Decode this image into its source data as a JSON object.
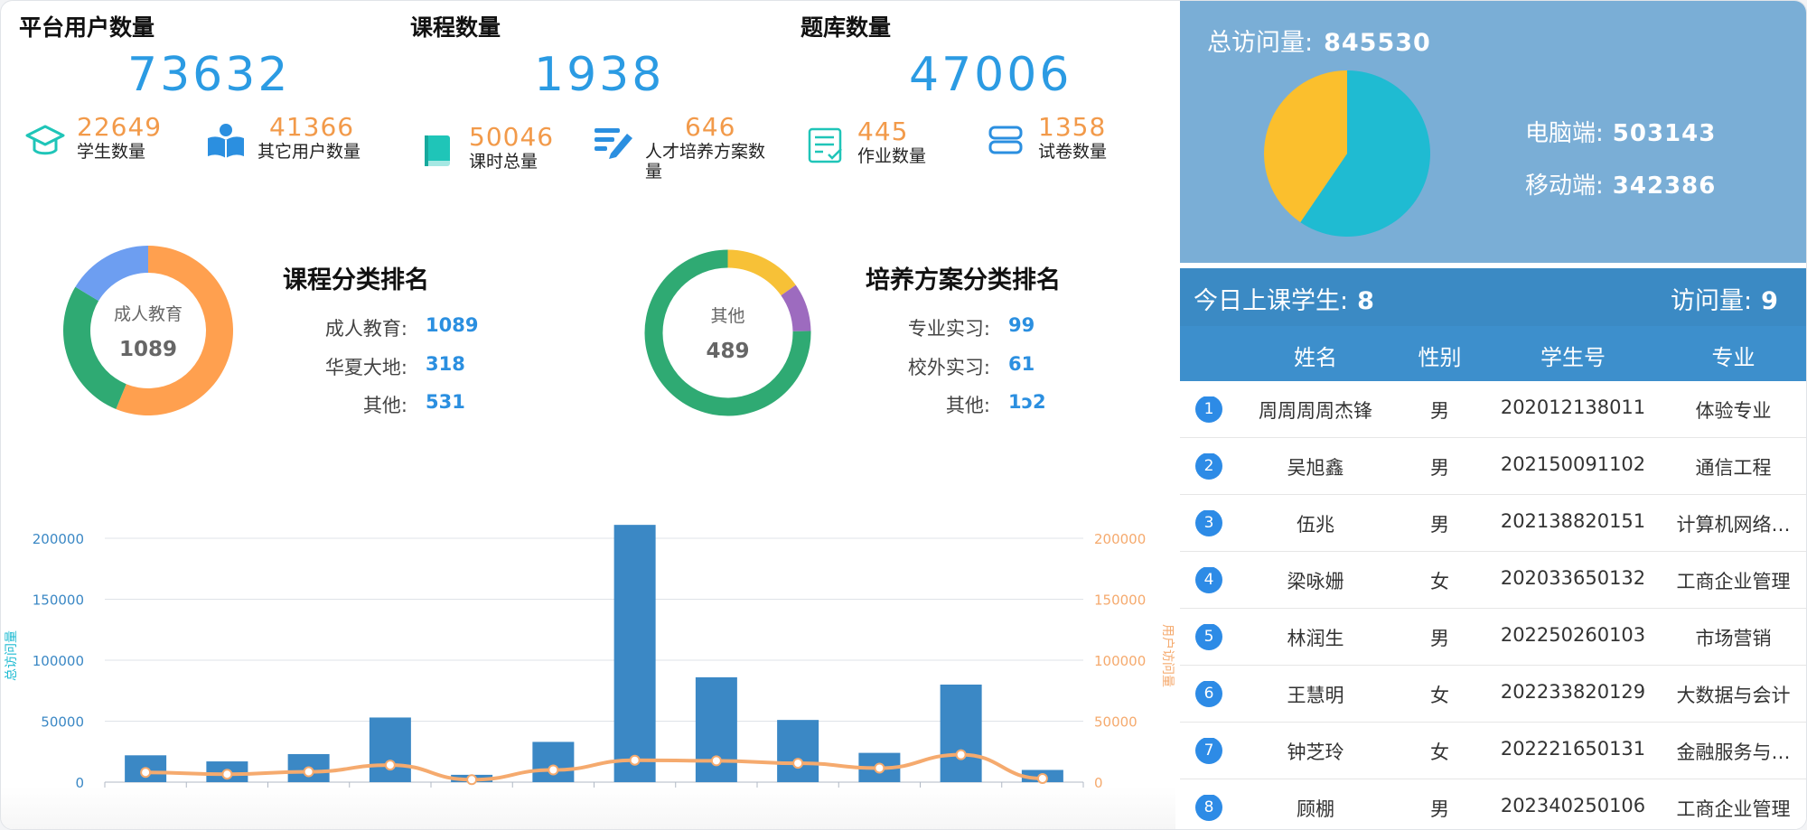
{
  "stats": [
    {
      "title": "平台用户数量",
      "value": "73632"
    },
    {
      "title": "课程数量",
      "value": "1938"
    },
    {
      "title": "题库数量",
      "value": "47006"
    }
  ],
  "subs": [
    {
      "num": "22649",
      "label": "学生数量",
      "icon": "graduation-cap-icon"
    },
    {
      "num": "41366",
      "label": "其它用户数量",
      "icon": "reading-person-icon"
    },
    {
      "num": "50046",
      "label": "课时总量",
      "icon": "book-icon"
    },
    {
      "num": "646",
      "label": "人才培养方案数量",
      "icon": "edit-list-icon"
    },
    {
      "num": "445",
      "label": "作业数量",
      "icon": "checklist-icon"
    },
    {
      "num": "1358",
      "label": "试卷数量",
      "icon": "stack-icon"
    }
  ],
  "course_rank": {
    "title": "课程分类排名",
    "center_name": "成人教育",
    "center_value": "1089",
    "items": [
      {
        "label": "成人教育:",
        "value": "1089"
      },
      {
        "label": "华夏大地:",
        "value": "318"
      },
      {
        "label": "其他:",
        "value": "531"
      }
    ]
  },
  "plan_rank": {
    "title": "培养方案分类排名",
    "center_name": "其他",
    "center_value": "489",
    "items": [
      {
        "label": "专业实习:",
        "value": "99"
      },
      {
        "label": "校外实习:",
        "value": "61"
      },
      {
        "label": "其他:",
        "value": "1ɔ2"
      }
    ]
  },
  "colors": {
    "blue": "#2b9be3",
    "orange": "#f29a4a",
    "course_slices": [
      "#ffa04f",
      "#2faa73",
      "#6d9ef1"
    ],
    "plan_slices": [
      "#2faa73",
      "#f7c137",
      "#9d6bbf"
    ],
    "bar": "#3b88c5",
    "line": "#f5aa6e",
    "pie_cyan": "#1fbbd2",
    "pie_yellow": "#fbbf2d"
  },
  "chart_data": {
    "type": "bar",
    "ylabel": "总访问量",
    "y2label": "用户访问量",
    "ylim": [
      0,
      200000
    ],
    "yticks": [
      "0",
      "50000",
      "100000",
      "150000",
      "200000"
    ],
    "series": [
      {
        "values": [
          22000,
          17000,
          23000,
          53000,
          6000,
          33000,
          211000,
          86000,
          51000,
          24000,
          80000,
          10000
        ]
      },
      {
        "values": [
          8000,
          6500,
          8500,
          14000,
          2000,
          10000,
          18000,
          17500,
          15500,
          11500,
          22500,
          3000
        ]
      }
    ]
  },
  "visits": {
    "total_label": "总访问量:",
    "total_value": "845530",
    "pc_label": "电脑端:",
    "pc_value": "503143",
    "mobile_label": "移动端:",
    "mobile_value": "342386"
  },
  "today": {
    "students_label": "今日上课学生:",
    "students_value": "8",
    "visits_label": "访问量:",
    "visits_value": "9"
  },
  "table": {
    "headers": [
      "姓名",
      "性别",
      "学生号",
      "专业"
    ],
    "rows": [
      {
        "idx": "1",
        "name": "周周周周杰锋",
        "sex": "男",
        "id": "202012138011",
        "major": "体验专业"
      },
      {
        "idx": "2",
        "name": "吴旭鑫",
        "sex": "男",
        "id": "202150091102",
        "major": "通信工程"
      },
      {
        "idx": "3",
        "name": "伍兆",
        "sex": "男",
        "id": "202138820151",
        "major": "计算机网络…"
      },
      {
        "idx": "4",
        "name": "梁咏姗",
        "sex": "女",
        "id": "202033650132",
        "major": "工商企业管理"
      },
      {
        "idx": "5",
        "name": "林润生",
        "sex": "男",
        "id": "202250260103",
        "major": "市场营销"
      },
      {
        "idx": "6",
        "name": "王慧明",
        "sex": "女",
        "id": "202233820129",
        "major": "大数据与会计"
      },
      {
        "idx": "7",
        "name": "钟芝玲",
        "sex": "女",
        "id": "202221650131",
        "major": "金融服务与…"
      },
      {
        "idx": "8",
        "name": "顾棚",
        "sex": "男",
        "id": "202340250106",
        "major": "工商企业管理"
      }
    ]
  }
}
